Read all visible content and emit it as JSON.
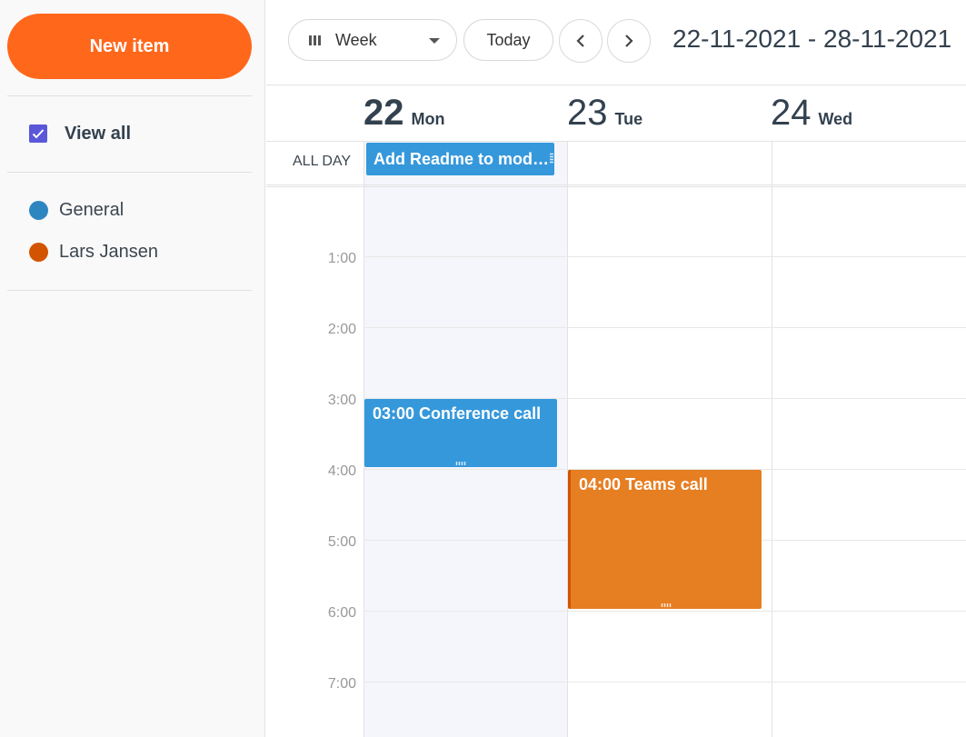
{
  "sidebar": {
    "new_item_label": "New item",
    "view_all_label": "View all",
    "view_all_checked": true,
    "calendars": [
      {
        "label": "General",
        "color": "#2e86c1"
      },
      {
        "label": "Lars Jansen",
        "color": "#d35400"
      }
    ]
  },
  "toolbar": {
    "view_select": "Week",
    "today_label": "Today",
    "prev_icon": "chevron-left-icon",
    "next_icon": "chevron-right-icon",
    "date_range": "22-11-2021 - 28-11-2021"
  },
  "calendar": {
    "days": [
      {
        "num": "22",
        "name": "Mon",
        "today": true
      },
      {
        "num": "23",
        "name": "Tue",
        "today": false
      },
      {
        "num": "24",
        "name": "Wed",
        "today": false
      }
    ],
    "all_day_label": "ALL DAY",
    "hours": [
      "1:00",
      "2:00",
      "3:00",
      "4:00",
      "5:00",
      "6:00",
      "7:00"
    ],
    "all_day_events": [
      {
        "title": "Add Readme to modules",
        "day": 0,
        "color": "#3598db"
      }
    ],
    "events": [
      {
        "title": "03:00 Conference call",
        "day": 0,
        "start": 3,
        "end": 4,
        "color": "#3598db"
      },
      {
        "title": "04:00 Teams call",
        "day": 1,
        "start": 4,
        "end": 6,
        "color": "#e67e22"
      }
    ]
  },
  "colors": {
    "accent": "#ff671b",
    "checkbox": "#5b57d9",
    "today_column": "#f5f6fc"
  }
}
